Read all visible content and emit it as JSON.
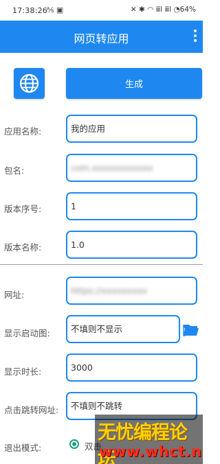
{
  "status_bar": {
    "time": "17:38:26",
    "left_icons": "⅍ ▣",
    "right_indicators": "✕ ✱ ◠ ⅲl ⅲl ◔",
    "battery": "64%"
  },
  "app_bar": {
    "title": "网页转应用",
    "menu_icon": "more-vert-icon"
  },
  "actions": {
    "globe_icon": "globe-icon",
    "generate_label": "生成"
  },
  "form": {
    "app_name": {
      "label": "应用名称:",
      "value": "我的应用"
    },
    "package": {
      "label": "包名:",
      "value": "com.xxxxxxxxxxxx"
    },
    "version_code": {
      "label": "版本序号:",
      "value": "1"
    },
    "version_name": {
      "label": "版本名称:",
      "value": "1.0"
    },
    "url": {
      "label": "网址:",
      "value": "https://xxxxxxxxx"
    },
    "splash_image": {
      "label": "显示启动图:",
      "value": "不填则不显示",
      "browse_icon": "folder-icon"
    },
    "splash_duration": {
      "label": "显示时长:",
      "value": "3000"
    },
    "click_url": {
      "label": "点击跳转网址:",
      "value": "不填则不跳转"
    },
    "exit_mode": {
      "label": "退出模式:",
      "option": "双击"
    }
  },
  "watermark": {
    "line1": "无忧编程论坛",
    "line2": "www.whct.net"
  },
  "colors": {
    "primary": "#1e88f0",
    "radio": "#1b9e85",
    "watermark_yellow": "#ffd200",
    "watermark_red": "#ff2b1b"
  }
}
